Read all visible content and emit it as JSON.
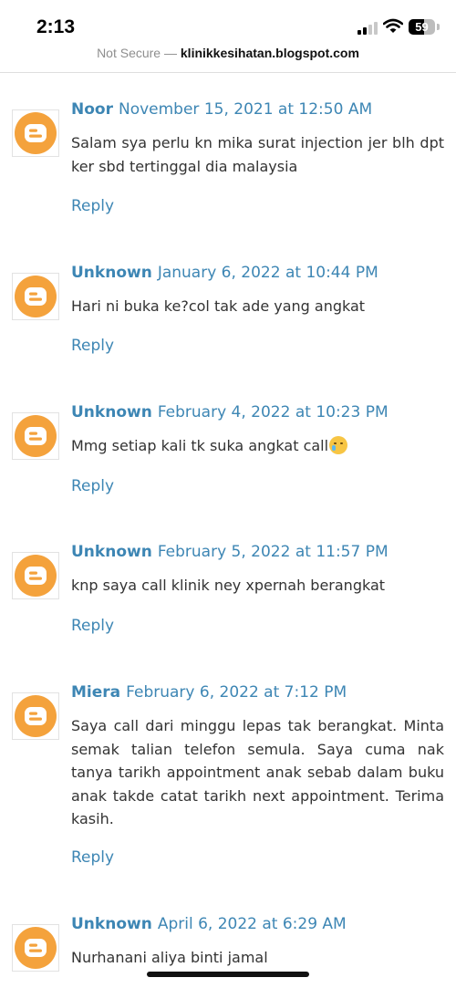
{
  "status_bar": {
    "time": "2:13",
    "battery": "59"
  },
  "browser": {
    "security_label": "Not Secure",
    "separator": " — ",
    "domain": "klinikkesihatan.blogspot.com"
  },
  "comments": [
    {
      "author": "Noor",
      "date": "November 15, 2021 at 12:50 AM",
      "text": "Salam sya perlu kn mika surat injection jer blh dpt ker sbd tertinggal dia malaysia",
      "reply": "Reply"
    },
    {
      "author": "Unknown",
      "date": "January 6, 2022 at 10:44 PM",
      "text": "Hari ni buka ke?col tak ade yang angkat",
      "reply": "Reply"
    },
    {
      "author": "Unknown",
      "date": "February 4, 2022 at 10:23 PM",
      "text": "Mmg setiap kali tk suka angkat call",
      "emoji": "face-holding-back-tears",
      "reply": "Reply"
    },
    {
      "author": "Unknown",
      "date": "February 5, 2022 at 11:57 PM",
      "text": "knp saya call klinik ney xpernah berangkat",
      "reply": "Reply"
    },
    {
      "author": "Miera",
      "date": "February 6, 2022 at 7:12 PM",
      "text": "Saya call dari minggu lepas tak berangkat. Minta semak talian telefon semula. Saya cuma nak tanya tarikh appointment anak sebab dalam buku anak takde catat tarikh next appointment. Terima kasih.",
      "reply": "Reply"
    },
    {
      "author": "Unknown",
      "date": "April 6, 2022 at 6:29 AM",
      "text": "Nurhanani aliya binti jamal"
    }
  ],
  "icons": {
    "avatar": "blogger-logo-icon",
    "signal": "cellular-signal-icon",
    "wifi": "wifi-icon",
    "battery": "battery-icon"
  },
  "colors": {
    "link": "#3d86b4",
    "blogger_orange": "#f4a23c",
    "text": "#333333"
  }
}
